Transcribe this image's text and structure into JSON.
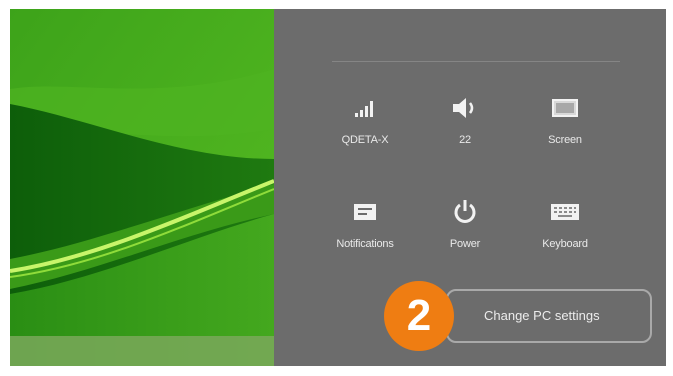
{
  "desktop": {
    "wallpaper_colors": {
      "base": "#2f8f12",
      "dark": "#0b5a08",
      "light": "#6fcb2a",
      "streak": "#c8f56a"
    }
  },
  "charm_panel": {
    "background": "#6c6c6c",
    "settings_tiles": [
      {
        "label": "QDETA-X",
        "icon": "network-signal-icon"
      },
      {
        "label": "22",
        "icon": "volume-icon"
      },
      {
        "label": "Screen",
        "icon": "screen-brightness-icon"
      },
      {
        "label": "Notifications",
        "icon": "notifications-icon"
      },
      {
        "label": "Power",
        "icon": "power-icon"
      },
      {
        "label": "Keyboard",
        "icon": "keyboard-icon"
      }
    ],
    "change_pc_settings_label": "Change PC settings",
    "step_badge": {
      "text": "2",
      "color": "#ef7d12"
    }
  }
}
